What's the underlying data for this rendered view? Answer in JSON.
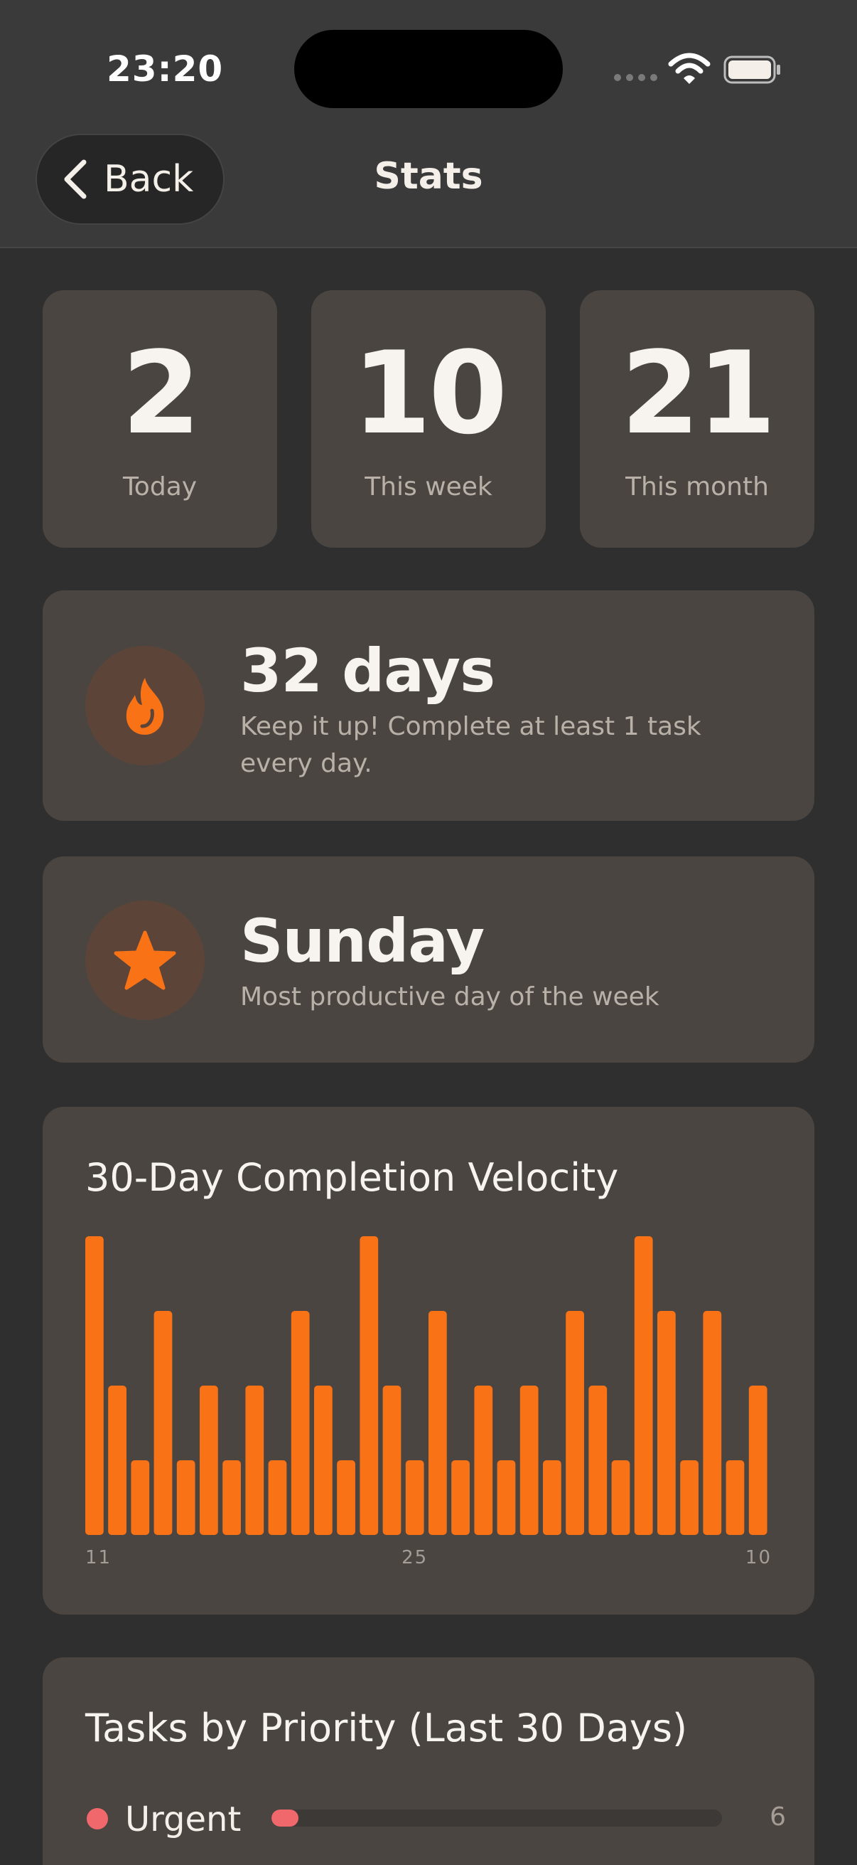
{
  "status_bar": {
    "time": "23:20"
  },
  "header": {
    "back_label": "Back",
    "title": "Stats"
  },
  "stats": [
    {
      "value": "2",
      "label": "Today"
    },
    {
      "value": "10",
      "label": "This week"
    },
    {
      "value": "21",
      "label": "This month"
    }
  ],
  "streak": {
    "title": "32 days",
    "subtitle": "Keep it up! Complete at least 1 task every day.",
    "icon": "flame-icon"
  },
  "productive_day": {
    "title": "Sunday",
    "subtitle": "Most productive day of the week",
    "icon": "star-icon"
  },
  "colors": {
    "accent": "#f97316",
    "urgent": "#f0686b",
    "card": "#4a4541",
    "background": "#2f2f2f"
  },
  "chart_data": {
    "type": "bar",
    "title": "30-Day Completion Velocity",
    "x_tick_labels": [
      {
        "index": 0,
        "label": "11"
      },
      {
        "index": 14,
        "label": "25"
      },
      {
        "index": 29,
        "label": "10"
      }
    ],
    "values": [
      4,
      2,
      1,
      3,
      1,
      2,
      1,
      2,
      1,
      3,
      2,
      1,
      4,
      2,
      1,
      3,
      1,
      2,
      1,
      2,
      1,
      3,
      2,
      1,
      4,
      3,
      1,
      3,
      1,
      2
    ],
    "ylim": [
      0,
      4
    ],
    "grid": false,
    "legend": "none"
  },
  "priority": {
    "title": "Tasks by Priority (Last 30 Days)",
    "items": [
      {
        "label": "Urgent",
        "count": "6",
        "fraction": 0.06,
        "color": "#f0686b"
      }
    ]
  }
}
